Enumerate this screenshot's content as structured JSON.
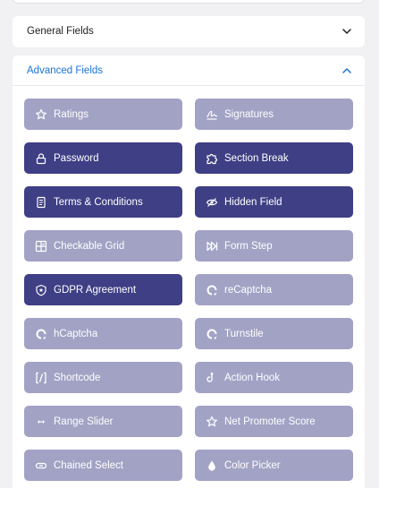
{
  "general": {
    "title": "General Fields"
  },
  "advanced": {
    "title": "Advanced Fields",
    "fields": [
      {
        "label": "Ratings",
        "icon": "star-icon",
        "style": "light"
      },
      {
        "label": "Signatures",
        "icon": "signature-icon",
        "style": "light"
      },
      {
        "label": "Password",
        "icon": "lock-icon",
        "style": "dark"
      },
      {
        "label": "Section Break",
        "icon": "puzzle-icon",
        "style": "dark"
      },
      {
        "label": "Terms & Conditions",
        "icon": "document-icon",
        "style": "dark"
      },
      {
        "label": "Hidden Field",
        "icon": "eye-slash-icon",
        "style": "dark"
      },
      {
        "label": "Checkable Grid",
        "icon": "grid-icon",
        "style": "light"
      },
      {
        "label": "Form Step",
        "icon": "step-forward-icon",
        "style": "light"
      },
      {
        "label": "GDPR Agreement",
        "icon": "shield-icon",
        "style": "dark"
      },
      {
        "label": "reCaptcha",
        "icon": "captcha-icon",
        "style": "light"
      },
      {
        "label": "hCaptcha",
        "icon": "captcha-icon",
        "style": "light"
      },
      {
        "label": "Turnstile",
        "icon": "captcha-icon",
        "style": "light"
      },
      {
        "label": "Shortcode",
        "icon": "shortcode-icon",
        "style": "light"
      },
      {
        "label": "Action Hook",
        "icon": "hook-icon",
        "style": "light"
      },
      {
        "label": "Range Slider",
        "icon": "range-icon",
        "style": "light"
      },
      {
        "label": "Net Promoter Score",
        "icon": "star-icon",
        "style": "light"
      },
      {
        "label": "Chained Select",
        "icon": "link-icon",
        "style": "light"
      },
      {
        "label": "Color Picker",
        "icon": "droplet-icon",
        "style": "light"
      }
    ]
  },
  "colors": {
    "light_button": "#a2a2c5",
    "dark_button": "#3f3f85",
    "accent": "#1a73d6"
  }
}
